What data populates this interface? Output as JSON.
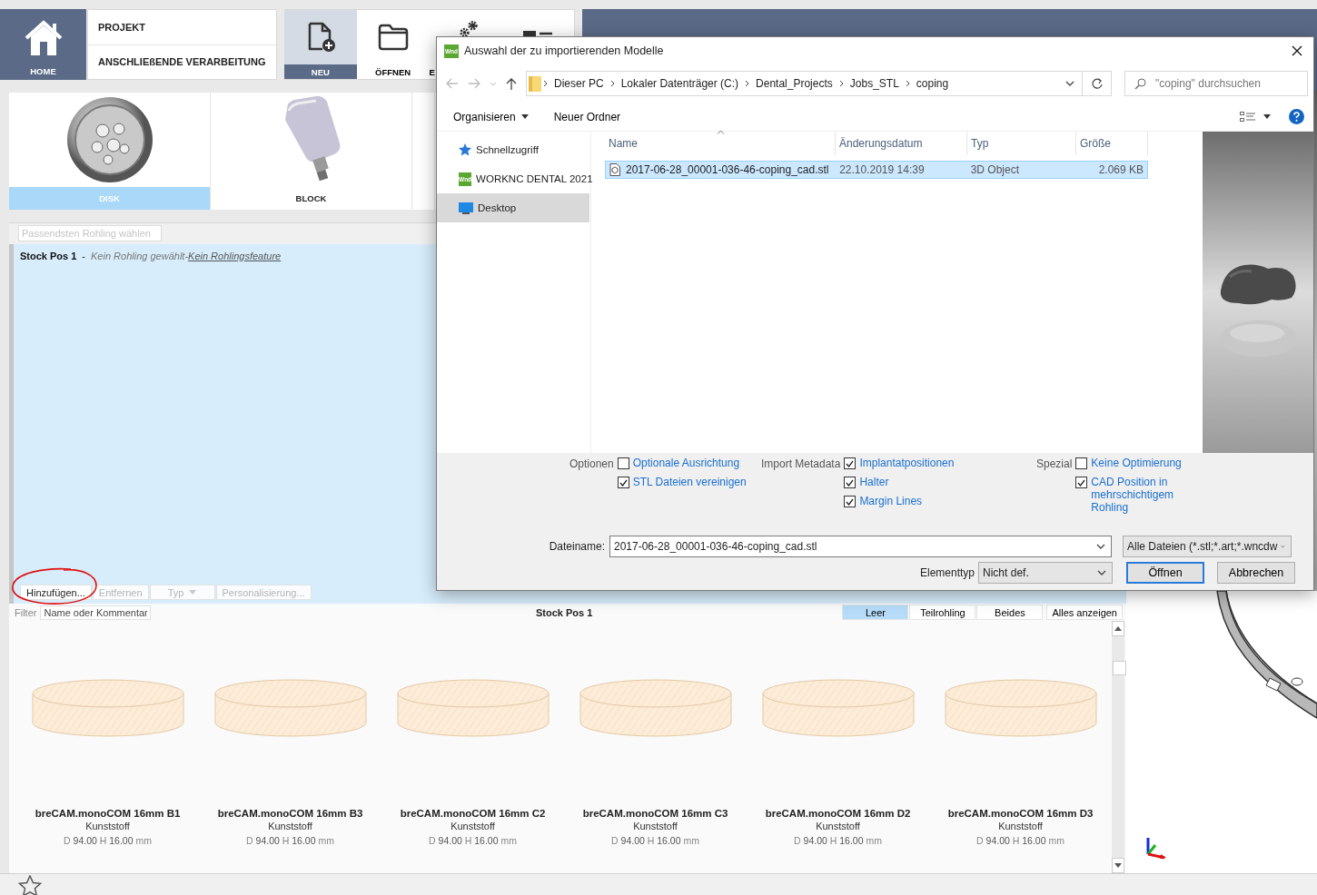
{
  "ribbon": {
    "home": {
      "label": "HOME"
    },
    "menu": [
      {
        "label": "PROJEKT"
      },
      {
        "label": "ANSCHLIEßENDE VERARBEITUNG"
      }
    ],
    "tools": [
      {
        "label": "NEU",
        "kind": "new",
        "selected": true
      },
      {
        "label": "ÖFFNEN",
        "kind": "folder",
        "selected": false
      },
      {
        "label": "E",
        "kind": "gears",
        "selected": false
      },
      {
        "kind": "image-list",
        "selected": false
      }
    ]
  },
  "stock_types": [
    {
      "label": "DISK",
      "kind": "disk",
      "selected": true
    },
    {
      "label": "BLOCK",
      "kind": "block",
      "selected": false
    }
  ],
  "search": {
    "placeholder": "Passendsten Rohling wählen"
  },
  "stock_positions": [
    {
      "name": "Stock Pos 1",
      "separator": "-",
      "status": "Kein Rohling gewählt",
      "joiner": "-",
      "link": "Kein Rohlingsfeature"
    }
  ],
  "stock_actions": [
    {
      "label": "Hinzufügen...",
      "kind": "button",
      "disabled": false
    },
    {
      "label": "Entfernen",
      "kind": "button",
      "disabled": true
    },
    {
      "label": "Typ",
      "kind": "dropdown",
      "disabled": true
    },
    {
      "label": "Personalisierung...",
      "kind": "button",
      "disabled": true
    }
  ],
  "library": {
    "filter_label": "Filter",
    "filter_placeholder": "Name oder Kommentar",
    "title": "Stock Pos 1",
    "filters": [
      {
        "label": "Leer",
        "selected": true
      },
      {
        "label": "Teilrohling",
        "selected": false
      },
      {
        "label": "Beides",
        "selected": false
      }
    ],
    "show_all": "Alles anzeigen",
    "items": [
      {
        "name": "breCAM.monoCOM 16mm B1",
        "material": "Kunststoff",
        "d_label": "D",
        "d": "94.00",
        "h_label": "H",
        "h": "16.00",
        "unit": "mm"
      },
      {
        "name": "breCAM.monoCOM 16mm B3",
        "material": "Kunststoff",
        "d_label": "D",
        "d": "94.00",
        "h_label": "H",
        "h": "16.00",
        "unit": "mm"
      },
      {
        "name": "breCAM.monoCOM 16mm C2",
        "material": "Kunststoff",
        "d_label": "D",
        "d": "94.00",
        "h_label": "H",
        "h": "16.00",
        "unit": "mm"
      },
      {
        "name": "breCAM.monoCOM 16mm C3",
        "material": "Kunststoff",
        "d_label": "D",
        "d": "94.00",
        "h_label": "H",
        "h": "16.00",
        "unit": "mm"
      },
      {
        "name": "breCAM.monoCOM 16mm D2",
        "material": "Kunststoff",
        "d_label": "D",
        "d": "94.00",
        "h_label": "H",
        "h": "16.00",
        "unit": "mm"
      },
      {
        "name": "breCAM.monoCOM 16mm D3",
        "material": "Kunststoff",
        "d_label": "D",
        "d": "94.00",
        "h_label": "H",
        "h": "16.00",
        "unit": "mm"
      }
    ]
  },
  "dialog": {
    "logo": "Wnd",
    "title": "Auswahl der zu importierenden Modelle",
    "breadcrumb": [
      "Dieser PC",
      "Lokaler Datenträger (C:)",
      "Dental_Projects",
      "Jobs_STL",
      "coping"
    ],
    "search_placeholder": "\"coping\" durchsuchen",
    "toolbar": [
      {
        "label": "Organisieren",
        "kind": "menu"
      },
      {
        "label": "Neuer Ordner",
        "kind": "button"
      }
    ],
    "nav": [
      {
        "label": "Schnellzugriff",
        "kind": "star",
        "selected": false
      },
      {
        "label": "WORKNC DENTAL 2021",
        "kind": "app",
        "badge": "Wnd",
        "selected": false
      },
      {
        "label": "Desktop",
        "kind": "desktop",
        "selected": true
      }
    ],
    "columns": [
      "Name",
      "Änderungsdatum",
      "Typ",
      "Größe"
    ],
    "files": [
      {
        "name": "2017-06-28_00001-036-46-coping_cad.stl",
        "date": "22.10.2019 14:39",
        "type": "3D Object",
        "size": "2.069 KB",
        "selected": true
      }
    ],
    "preview": {
      "kind": "picture"
    },
    "option_groups": [
      {
        "label": "Optionen",
        "options": [
          {
            "label": "Optionale Ausrichtung",
            "checked": false
          },
          {
            "label": "STL Dateien vereinigen",
            "checked": true
          }
        ]
      },
      {
        "label": "Import Metadata",
        "options": [
          {
            "label": "Implantatpositionen",
            "checked": true
          },
          {
            "label": "Halter",
            "checked": true
          },
          {
            "label": "Margin Lines",
            "checked": true
          }
        ]
      },
      {
        "label": "Spezial",
        "options": [
          {
            "label": "Keine Optimierung",
            "checked": false
          },
          {
            "label": "CAD Position in mehrschichtigem Rohling",
            "checked": true
          }
        ]
      }
    ],
    "filename_label": "Dateiname:",
    "filename": "2017-06-28_00001-036-46-coping_cad.stl",
    "filetype": "Alle Dateien (*.stl;*.art;*.wncdw",
    "elementtype_label": "Elementtyp",
    "elementtype": "Nicht def.",
    "buttons": [
      {
        "label": "Öffnen",
        "kind": "primary"
      },
      {
        "label": "Abbrechen",
        "kind": "secondary"
      }
    ]
  }
}
